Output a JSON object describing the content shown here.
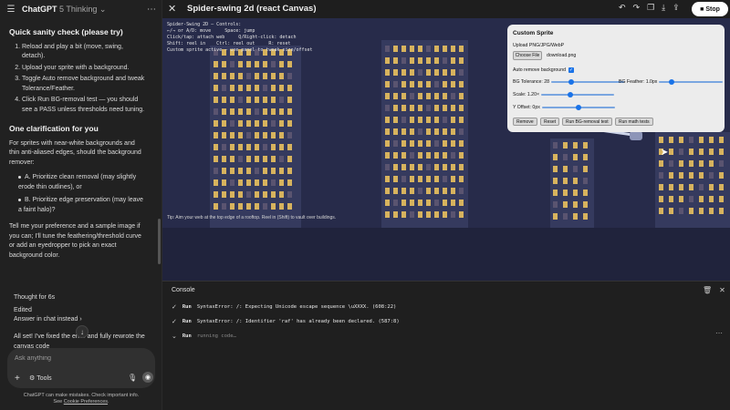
{
  "chat": {
    "model_name": "ChatGPT",
    "model_variant": "5 Thinking",
    "heading_sanity": "Quick sanity check (please try)",
    "steps": [
      "Reload and play a bit (move, swing, detach).",
      "Upload your sprite with a background.",
      "Toggle Auto remove background and tweak Tolerance/Feather.",
      "Click Run BG-removal test — you should see a PASS unless thresholds need tuning."
    ],
    "heading_clarification": "One clarification for you",
    "clarification_text": "For sprites with near-white backgrounds and thin anti-aliased edges, should the background remover:",
    "option_a": "A. Prioritize clean removal (may slightly erode thin outlines), or",
    "option_b": "B. Prioritize edge preservation (may leave a faint halo)?",
    "followup": "Tell me your preference and a sample image if you can; I'll tune the feathering/threshold curve or add an eyedropper to pick an exact background color.",
    "thought": "Thought for 6s",
    "edited": "Edited",
    "answer_in_chat": "Answer in chat instead",
    "final_message": "All set! I've fixed the error and fully rewrote the canvas code",
    "composer_placeholder": "Ask anything",
    "tools_label": "Tools",
    "disclaimer_line1": "ChatGPT can make mistakes. Check important info.",
    "disclaimer_see": "See",
    "disclaimer_link": "Cookie Preferences",
    "disclaimer_end": "."
  },
  "canvas": {
    "title": "Spider-swing 2d (react Canvas)",
    "stop_label": "Stop",
    "hud_text": "Spider-Swing 2D — Controls:\n←/→ or A/D: move     Space: jump\nClick/tap: attach web     Q/Right-click: detach\nShift: reel in    Ctrl: reel out     R: reset\nCustom sprite active — use panel to tweak size/offset",
    "tip": "Tip: Aim your web at the top edge of a rooftop. Reel in (Shift) to vault over buildings.",
    "custom_sprite": {
      "title": "Custom Sprite",
      "upload_label": "Upload PNG/JPG/WebP",
      "choose_file": "Choose File",
      "file_name": "download.png",
      "auto_remove": "Auto remove background",
      "auto_remove_checked": true,
      "bg_tolerance_label": "BG Tolerance: 28",
      "bg_tolerance_value": 0.28,
      "bg_feather_label": "BG Feather: 1.0px",
      "bg_feather_value": 0.2,
      "scale_label": "Scale: 1.20×",
      "scale_value": 0.4,
      "y_offset_label": "Y Offset: 0px",
      "y_offset_value": 0.5,
      "buttons": [
        "Remove",
        "Reset",
        "Run BG-removal test",
        "Run math tests"
      ]
    }
  },
  "console": {
    "title": "Console",
    "logs": [
      {
        "prefix": "Run",
        "message": "SyntaxError: /: Expecting Unicode escape sequence \\uXXXX. (608:22)"
      },
      {
        "prefix": "Run",
        "message": "SyntaxError: /: Identifier 'raf' has already been declared. (587:8)"
      },
      {
        "prefix": "Run",
        "message": "running code…"
      }
    ]
  }
}
